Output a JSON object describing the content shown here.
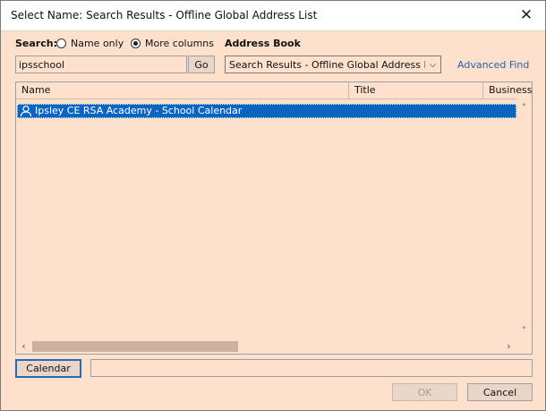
{
  "window": {
    "title": "Select Name: Search Results - Offline Global Address List",
    "close_glyph": "✕"
  },
  "search": {
    "label": "Search:",
    "option_name_only": "Name only",
    "option_more_columns": "More columns",
    "selected_option": "More columns",
    "query_value": "ipsschool",
    "go_label": "Go"
  },
  "address_book": {
    "label": "Address Book",
    "selected": "Search Results - Offline Global Address List",
    "arrow_glyph": "⌵",
    "advanced_find": "Advanced Find"
  },
  "results": {
    "columns": [
      "Name",
      "Title",
      "Business"
    ],
    "rows": [
      {
        "name": "Ipsley CE RSA Academy - School Calendar",
        "icon": "contact-person-icon",
        "selected": true
      }
    ],
    "scroll_up": "˄",
    "scroll_down": "˅",
    "scroll_left": "‹",
    "scroll_right": "›"
  },
  "footer": {
    "recipient_button": "Calendar",
    "recipient_value": "",
    "ok_label": "OK",
    "cancel_label": "Cancel"
  },
  "colors": {
    "dialog_background": "#fde1cc",
    "selection": "#0a64c0",
    "link": "#2b5ea8"
  }
}
